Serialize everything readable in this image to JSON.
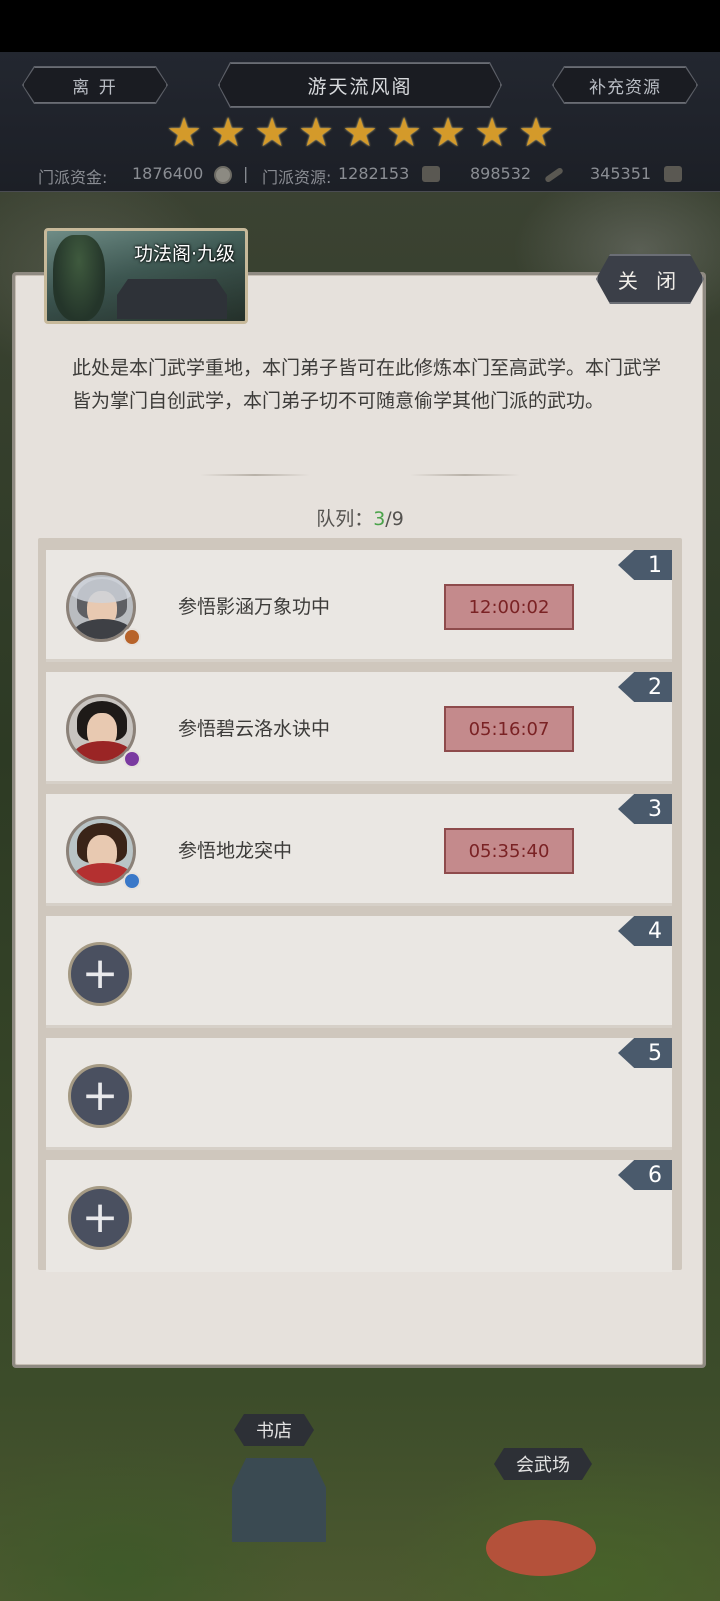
{
  "topbar": {
    "leave_label": "离 开",
    "title": "游天流风阁",
    "supplement_label": "补充资源",
    "stars": 9,
    "funds_label": "门派资金:",
    "funds_value": "1876400",
    "separator": "|",
    "resources_label": "门派资源:",
    "resource_1": "1282153",
    "resource_2": "898532",
    "resource_3": "345351"
  },
  "panel": {
    "thumb_title": "功法阁·九级",
    "close_label": "关 闭",
    "description": "此处是本门武学重地，本门弟子皆可在此修炼本门至高武学。本门武学皆为掌门自创武学，本门弟子切不可随意偷学其他门派的武功。",
    "queue_label": "队列：",
    "queue_current": "3",
    "queue_total": "/9"
  },
  "slots": [
    {
      "num": "1",
      "text": "参悟影涵万象功中",
      "timer": "12:00:02"
    },
    {
      "num": "2",
      "text": "参悟碧云洛水诀中",
      "timer": "05:16:07"
    },
    {
      "num": "3",
      "text": "参悟地龙突中",
      "timer": "05:35:40"
    },
    {
      "num": "4",
      "add": "+"
    },
    {
      "num": "5",
      "add": "+"
    },
    {
      "num": "6",
      "add": "+"
    }
  ],
  "map": {
    "bookstore": "书店",
    "arena": "会武场"
  },
  "colors": {
    "star": "#d49a2a",
    "timer_bg": "#c48a8c",
    "slot_num_bg": "#4a5a6c",
    "queue_current": "#4aa34a"
  }
}
